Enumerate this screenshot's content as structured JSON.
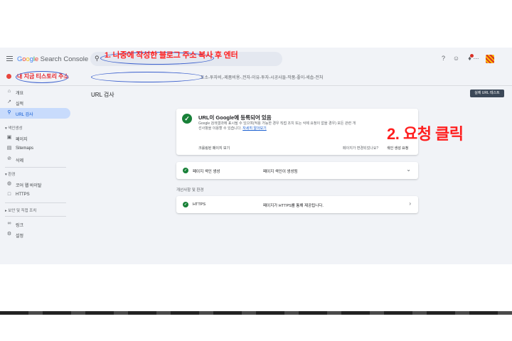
{
  "header": {
    "logo_google": "Google",
    "logo_product": "Search Console",
    "search_placeholder": ""
  },
  "property": {
    "name": "내 지금 티스토리 주소",
    "url_tail": "도소-투자비,-제품비용-,전자-이유-투자-시공사들-작품-좋이-세솝-전처"
  },
  "sidebar": {
    "items_top": [
      {
        "icon": "home-icon",
        "label": "개요"
      },
      {
        "icon": "trend-icon",
        "label": "실적"
      },
      {
        "icon": "search-icon",
        "label": "URL 검사",
        "active": true
      }
    ],
    "section_index": "색인생성",
    "items_index": [
      {
        "icon": "pages-icon",
        "label": "페이지"
      },
      {
        "icon": "sitemap-icon",
        "label": "Sitemaps"
      },
      {
        "icon": "remove-icon",
        "label": "삭제"
      }
    ],
    "section_experience": "환경",
    "items_experience": [
      {
        "icon": "vitals-icon",
        "label": "코어 웹 바이탈"
      },
      {
        "icon": "lock-icon",
        "label": "HTTPS"
      }
    ],
    "section_security": "보안 및 직접 조치",
    "items_bottom": [
      {
        "icon": "links-icon",
        "label": "링크"
      },
      {
        "icon": "settings-icon",
        "label": "설정"
      }
    ]
  },
  "main": {
    "title": "URL 검사",
    "test_button": "실제 URL 테스트",
    "status_title": "URL이 Google에 등록되어 있음",
    "status_desc": "Google 검색결과에 표시될 수 있으며(적용 가능한 경우 직접 조치 또는 삭제 요청이 없을 경우) 모든 관련 개선사항을 이용할 수 있습니다.",
    "status_desc_link": "자세히 알아보기",
    "crawl_link": "크롤링된 페이지 보기",
    "changed_q": "페이지가 변경되었나요?",
    "request_link": "색인 생성 요청",
    "rows": [
      {
        "label": "페이지 색인 생성",
        "value": "페이지 색인이 생성됨"
      }
    ],
    "section_label": "개선사항 및 환경",
    "rows2": [
      {
        "label": "HTTPS",
        "value": "페이지가 HTTPS를 통해 제공됩니다."
      }
    ]
  },
  "annotations": {
    "step1": "1. 나중에 작성한 블로그 주소 복사 후 엔터",
    "step2": "2. 요청 클릭"
  },
  "colors": {
    "accent": "#0b57d0",
    "success": "#188038",
    "annotation": "#ff1e1e"
  }
}
